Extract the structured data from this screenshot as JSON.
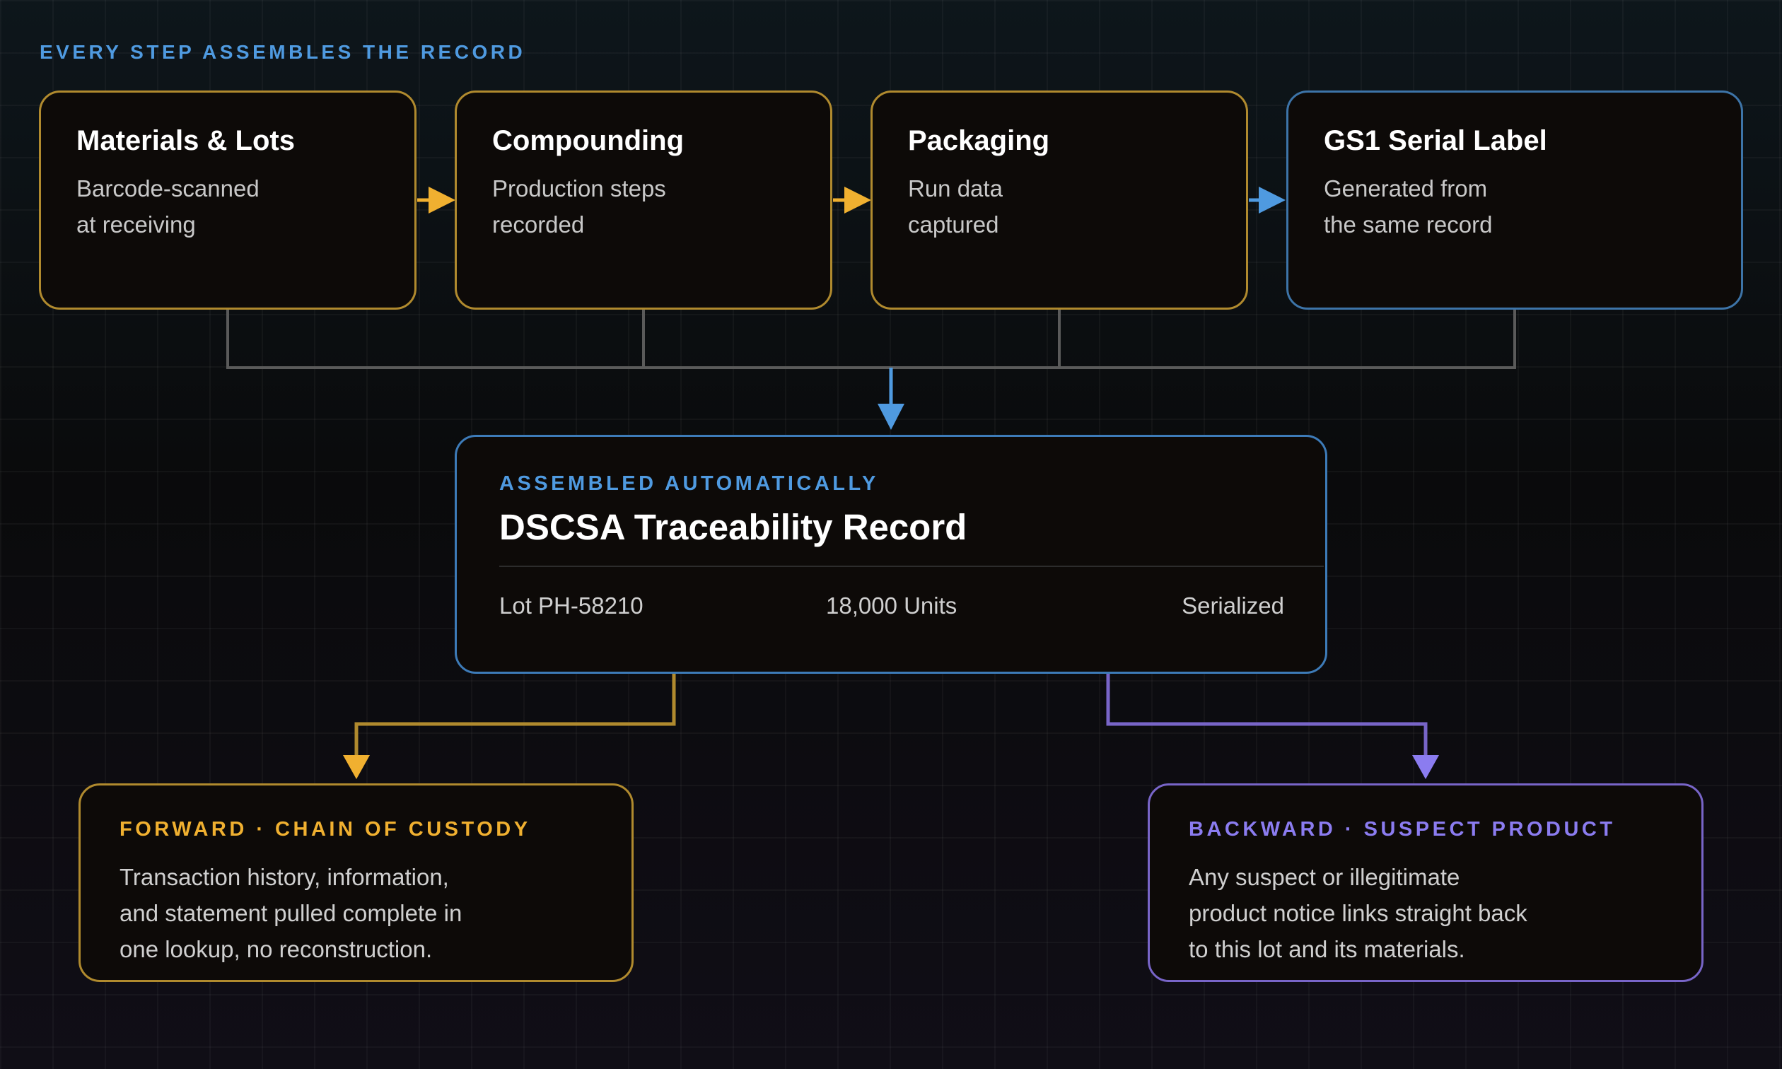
{
  "header": {
    "eyebrow": "EVERY STEP ASSEMBLES THE RECORD"
  },
  "colors": {
    "gold": "#f0b030",
    "blue": "#4f9ae0",
    "purple": "#8b7cf0",
    "connector_gray": "#5a5a5a"
  },
  "steps": [
    {
      "title": "Materials & Lots",
      "desc_line1": "Barcode-scanned",
      "desc_line2": "at receiving"
    },
    {
      "title": "Compounding",
      "desc_line1": "Production steps",
      "desc_line2": "recorded"
    },
    {
      "title": "Packaging",
      "desc_line1": "Run data",
      "desc_line2": "captured"
    },
    {
      "title": "GS1 Serial Label",
      "desc_line1": "Generated from",
      "desc_line2": "the same record"
    }
  ],
  "record": {
    "eyebrow": "ASSEMBLED AUTOMATICALLY",
    "title": "DSCSA Traceability Record",
    "lot": "Lot PH-58210",
    "units": "18,000 Units",
    "status": "Serialized"
  },
  "outputs": {
    "forward": {
      "eyebrow": "FORWARD · CHAIN OF CUSTODY",
      "line1": "Transaction history, information,",
      "line2": "and statement pulled complete in",
      "line3": "one lookup, no reconstruction."
    },
    "backward": {
      "eyebrow": "BACKWARD · SUSPECT PRODUCT",
      "line1": "Any suspect or illegitimate",
      "line2": "product notice links straight back",
      "line3": "to this lot and its materials."
    }
  }
}
